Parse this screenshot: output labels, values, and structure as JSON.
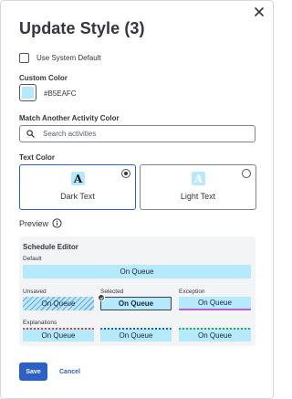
{
  "dialog": {
    "title": "Update Style (3)"
  },
  "system_default": {
    "label": "Use System Default",
    "checked": false
  },
  "custom_color": {
    "label": "Custom Color",
    "hex_label": "#B5EAFC",
    "color": "#B5EAFC"
  },
  "match_activity": {
    "label": "Match Another Activity Color",
    "placeholder": "Search activities",
    "value": ""
  },
  "text_color": {
    "label": "Text Color",
    "options": [
      {
        "label": "Dark Text",
        "selected": true,
        "glyph": "A"
      },
      {
        "label": "Light Text",
        "selected": false,
        "glyph": "A"
      }
    ]
  },
  "preview": {
    "label": "Preview",
    "info_icon": "info-circle-icon"
  },
  "schedule_editor": {
    "title": "Schedule Editor",
    "default_label": "Default",
    "default_block": "On Queue",
    "unsaved_label": "Unsaved",
    "unsaved_block": "On Queue",
    "selected_label": "Selected",
    "selected_block": "On Queue",
    "exception_label": "Exception",
    "exception_block": "On Queue",
    "explanations_label": "Explanations",
    "explanation_blocks": [
      "On Queue",
      "On Queue",
      "On Queue"
    ],
    "colors": {
      "block": "#B5EAFC",
      "exception_underline": "#C05BD0",
      "explanation_red": "#D9453A",
      "explanation_blue": "#2A60C8",
      "explanation_green": "#3FA34D"
    }
  },
  "footer": {
    "save_label": "Save",
    "cancel_label": "Cancel"
  },
  "colors": {
    "primary": "#2A60C8",
    "text": "#33363D"
  }
}
